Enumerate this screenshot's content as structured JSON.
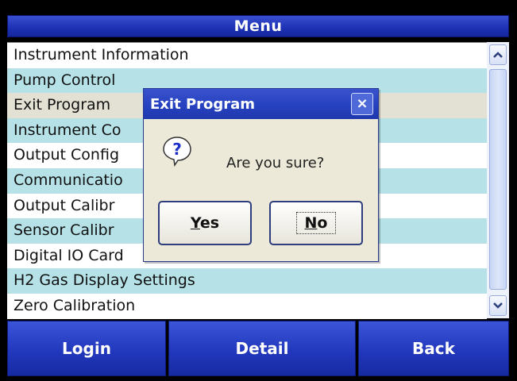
{
  "header": {
    "title": "Menu"
  },
  "menu": {
    "items": [
      "Instrument Information",
      "Pump Control",
      "Exit Program",
      "Instrument Co",
      "Output Config",
      "Communicatio",
      "Output Calibr",
      "Sensor Calibr",
      "Digital IO Card",
      "H2 Gas Display Settings",
      "Zero Calibration"
    ],
    "selected_index": 2
  },
  "scrollbar": {
    "up_icon": "chevron-up-icon",
    "down_icon": "chevron-down-icon"
  },
  "footer": {
    "buttons": [
      "Login",
      "Detail",
      "Back"
    ]
  },
  "dialog": {
    "title": "Exit Program",
    "close_label": "×",
    "message": "Are you sure?",
    "icon": "question-icon",
    "yes_first": "Y",
    "yes_rest": "es",
    "no_first": "N",
    "no_rest": "o"
  },
  "colors": {
    "bar_blue": "#2238bd",
    "row_alt": "#b5e1e7",
    "row_selected": "#e3e0d4",
    "dialog_bg": "#ece9d8"
  }
}
